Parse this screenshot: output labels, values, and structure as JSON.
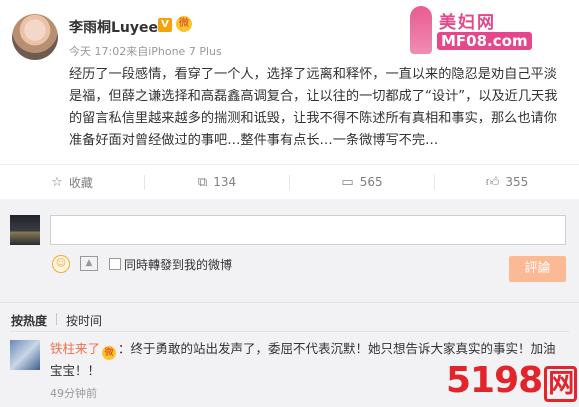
{
  "post": {
    "username": "李雨桐Luyee",
    "verified_badge": "V",
    "level_icon": "微",
    "meta": "今天 17:02来自iPhone 7 Plus",
    "content": "经历了一段感情，看穿了一个人，选择了远离和释怀，一直以来的隐忍是劝自己平淡是福，但薛之谦选择和高磊鑫高调复合，让以往的一切都成了“设计”，以及近几天我的留言私信里越来越多的揣测和诋毁，让我不得不陈述所有真相和事实，那么也请你准备好面对曾经做过的事吧…整件事有点长…一条微博写不完…"
  },
  "watermark_top": {
    "title": "美妇网",
    "url": "MF08.com"
  },
  "actions": [
    {
      "icon": "star-icon",
      "label": "收藏"
    },
    {
      "icon": "share-icon",
      "label": "134"
    },
    {
      "icon": "comment-icon",
      "label": "565"
    },
    {
      "icon": "like-icon",
      "label": "355"
    }
  ],
  "comment_box": {
    "checkbox_label": "同時轉發到我的微博",
    "submit_label": "評論"
  },
  "sort_tabs": {
    "by_hot": "按热度",
    "by_time": "按时间"
  },
  "comment": {
    "user": "铁柱来了",
    "level_icon": "微",
    "text": "：终于勇敢的站出发声了，委屈不代表沉默！她只想告诉大家真实的事实！加油宝宝！！",
    "time": "49分钟前"
  },
  "watermark_bottom": {
    "text": "5198",
    "suffix": "网"
  }
}
